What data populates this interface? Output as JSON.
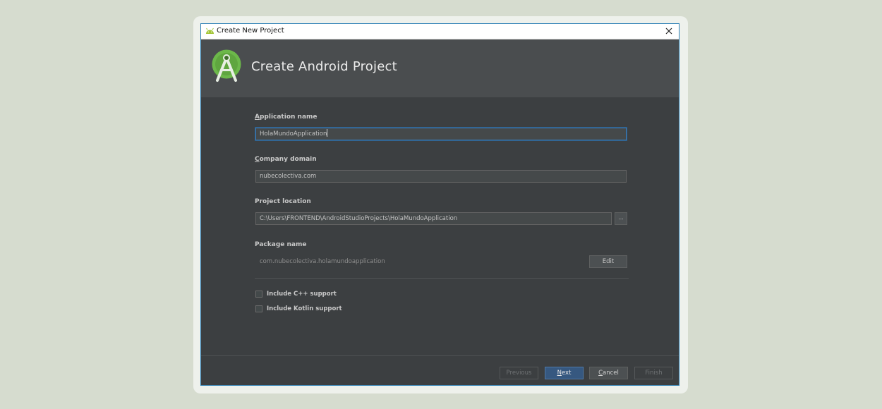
{
  "window": {
    "title": "Create New Project",
    "header_title": "Create Android Project"
  },
  "form": {
    "application_name": {
      "label_first": "A",
      "label_rest": "pplication name",
      "value": "HolaMundoApplication"
    },
    "company_domain": {
      "label_first": "C",
      "label_rest": "ompany domain",
      "value": "nubecolectiva.com"
    },
    "project_location": {
      "label": "Project location",
      "value": "C:\\Users\\FRONTEND\\AndroidStudioProjects\\HolaMundoApplication",
      "browse_label": "..."
    },
    "package_name": {
      "label": "Package name",
      "value": "com.nubecolectiva.holamundoapplication",
      "edit_label": "Edit"
    },
    "include_cpp": {
      "label": "Include C++ support",
      "checked": false
    },
    "include_kotlin": {
      "label": "Include Kotlin support",
      "checked": false
    }
  },
  "footer": {
    "previous": "Previous",
    "next_first": "N",
    "next_rest": "ext",
    "cancel_first": "C",
    "cancel_rest": "ancel",
    "finish": "Finish"
  },
  "colors": {
    "accent": "#3d7ab3",
    "primary_button": "#365880",
    "android_green": "#a4c639"
  },
  "icons": {
    "window_icon": "android-icon",
    "logo": "android-studio-logo",
    "close": "close-icon"
  }
}
